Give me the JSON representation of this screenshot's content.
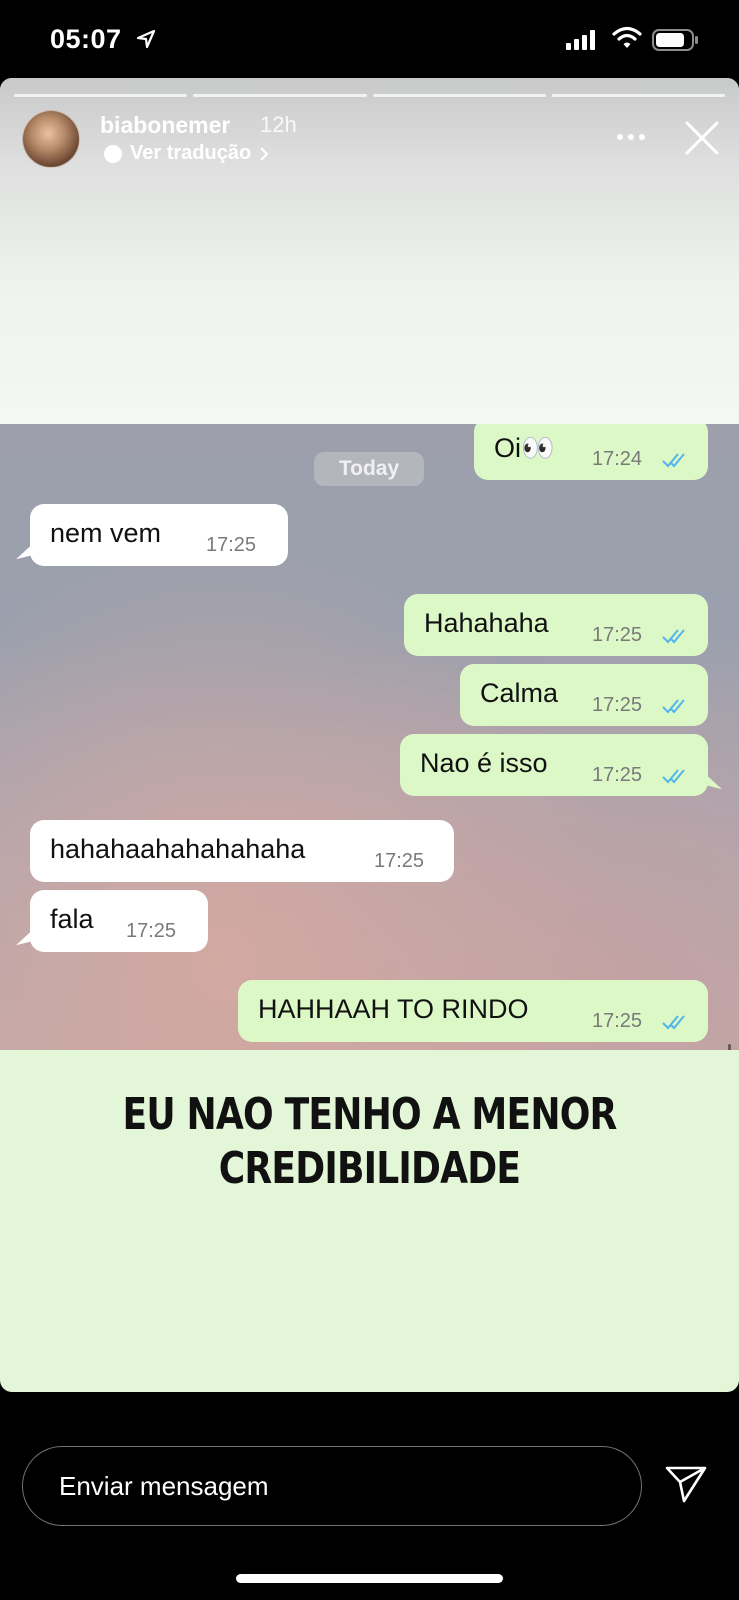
{
  "status_bar": {
    "time": "05:07"
  },
  "story": {
    "username": "biabonemer",
    "posted_ago": "12h",
    "translate_label": "Ver tradução",
    "caption_line1": "EU NAO TENHO A MENOR",
    "caption_line2": "CREDIBILIDADE"
  },
  "chat": {
    "date_separator": "Today",
    "messages": [
      {
        "direction": "out",
        "text": "Oi👀",
        "time": "17:24"
      },
      {
        "direction": "in",
        "text": "nem vem",
        "time": "17:25"
      },
      {
        "direction": "out",
        "text": "Hahahaha",
        "time": "17:25"
      },
      {
        "direction": "out",
        "text": "Calma",
        "time": "17:25"
      },
      {
        "direction": "out",
        "text": "Nao é isso",
        "time": "17:25"
      },
      {
        "direction": "in",
        "text": "hahahaahahahahaha",
        "time": "17:25"
      },
      {
        "direction": "in",
        "text": "fala",
        "time": "17:25"
      },
      {
        "direction": "out",
        "text": "HAHHAAH TO RINDO",
        "time": "17:25"
      }
    ],
    "colors": {
      "outgoing_bubble": "#dcf8c6",
      "incoming_bubble": "#ffffff",
      "read_ticks": "#4fb6ec"
    }
  },
  "reply_bar": {
    "placeholder": "Enviar mensagem"
  },
  "icons": [
    "location-arrow-icon",
    "signal-icon",
    "wifi-icon",
    "battery-icon",
    "more-options-icon",
    "close-icon",
    "translate-icon",
    "send-icon"
  ]
}
